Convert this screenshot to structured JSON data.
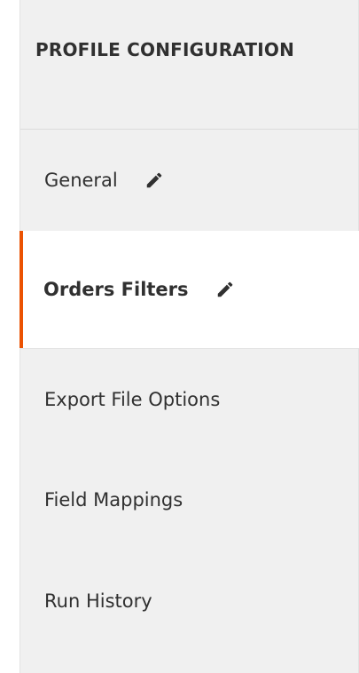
{
  "panel": {
    "title": "PROFILE CONFIGURATION"
  },
  "nav": {
    "items": [
      {
        "label": "General",
        "icon": "pencil-icon",
        "active": false
      },
      {
        "label": "Orders Filters",
        "icon": "pencil-icon",
        "active": true
      },
      {
        "label": "Export File Options",
        "active": false
      },
      {
        "label": "Field Mappings",
        "active": false
      },
      {
        "label": "Run History",
        "active": false
      }
    ]
  },
  "colors": {
    "panel_background": "#f0f0f0",
    "active_background": "#ffffff",
    "active_accent": "#eb5202",
    "text": "#303030"
  }
}
